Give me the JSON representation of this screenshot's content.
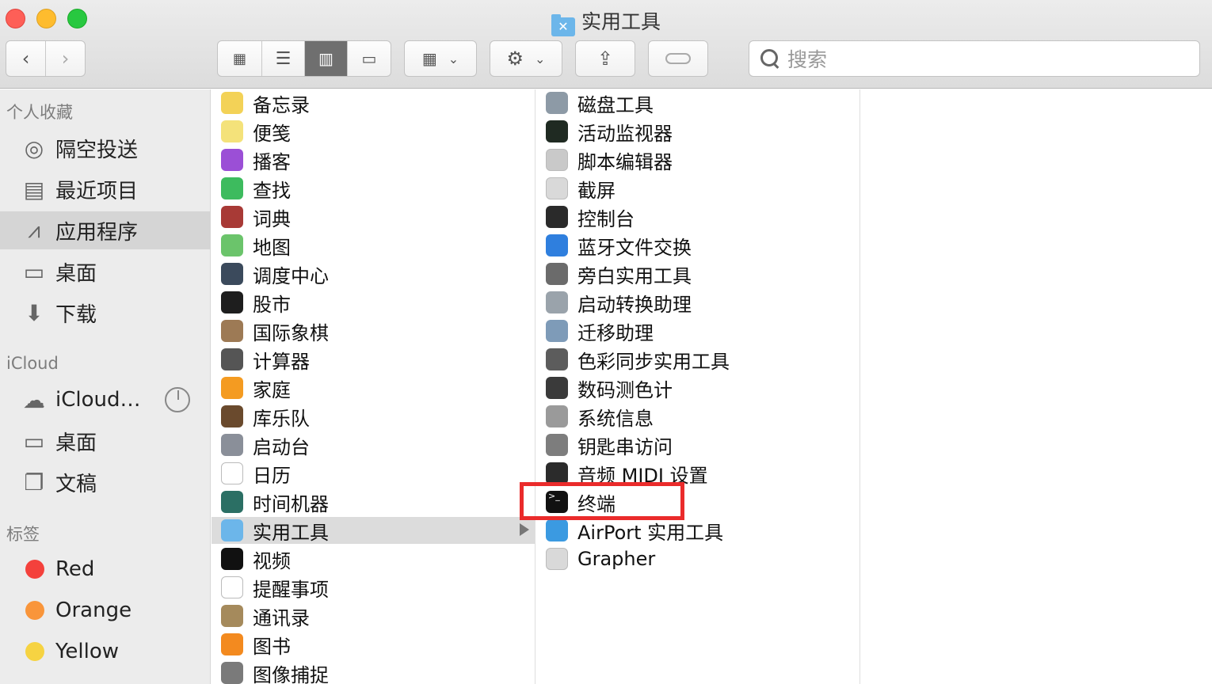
{
  "window": {
    "title": "实用工具"
  },
  "toolbar": {
    "back_icon": "chevron-left-icon",
    "forward_icon": "chevron-right-icon",
    "view_modes": [
      "icon-view",
      "list-view",
      "column-view",
      "gallery-view"
    ],
    "active_view": "column-view",
    "search_placeholder": "搜索"
  },
  "sidebar": {
    "favorites_header": "个人收藏",
    "favorites": [
      {
        "label": "隔空投送",
        "icon": "airdrop-icon"
      },
      {
        "label": "最近项目",
        "icon": "recents-icon"
      },
      {
        "label": "应用程序",
        "icon": "applications-icon",
        "selected": true
      },
      {
        "label": "桌面",
        "icon": "desktop-icon"
      },
      {
        "label": "下载",
        "icon": "downloads-icon"
      }
    ],
    "icloud_header": "iCloud",
    "icloud": [
      {
        "label": "iCloud…",
        "icon": "icloud-drive-icon"
      },
      {
        "label": "桌面",
        "icon": "desktop-icon"
      },
      {
        "label": "文稿",
        "icon": "documents-icon"
      }
    ],
    "tags_header": "标签",
    "tags": [
      {
        "label": "Red",
        "color": "#f4413c"
      },
      {
        "label": "Orange",
        "color": "#f9953a"
      },
      {
        "label": "Yellow",
        "color": "#f6d342"
      }
    ]
  },
  "column1": {
    "items": [
      {
        "label": "备忘录",
        "icon": "notes-icon",
        "color": "#f3d257"
      },
      {
        "label": "便笺",
        "icon": "stickies-icon",
        "color": "#f4e27a"
      },
      {
        "label": "播客",
        "icon": "podcasts-icon",
        "color": "#9b4fd6"
      },
      {
        "label": "查找",
        "icon": "find-my-icon",
        "color": "#3dbb5e"
      },
      {
        "label": "词典",
        "icon": "dictionary-icon",
        "color": "#a83a36"
      },
      {
        "label": "地图",
        "icon": "maps-icon",
        "color": "#6bc46b"
      },
      {
        "label": "调度中心",
        "icon": "mission-control-icon",
        "color": "#3b4a5c"
      },
      {
        "label": "股市",
        "icon": "stocks-icon",
        "color": "#1e1e1e"
      },
      {
        "label": "国际象棋",
        "icon": "chess-icon",
        "color": "#9d7a55"
      },
      {
        "label": "计算器",
        "icon": "calculator-icon",
        "color": "#555555"
      },
      {
        "label": "家庭",
        "icon": "home-icon",
        "color": "#f49b21"
      },
      {
        "label": "库乐队",
        "icon": "garageband-icon",
        "color": "#6a4a2d"
      },
      {
        "label": "启动台",
        "icon": "launchpad-icon",
        "color": "#8a8f99"
      },
      {
        "label": "日历",
        "icon": "calendar-icon",
        "color": "#ffffff"
      },
      {
        "label": "时间机器",
        "icon": "time-machine-icon",
        "color": "#2b6f64"
      },
      {
        "label": "实用工具",
        "icon": "utilities-folder-icon",
        "color": "#6cb6ea",
        "selected": true
      },
      {
        "label": "视频",
        "icon": "apple-tv-icon",
        "color": "#111111"
      },
      {
        "label": "提醒事项",
        "icon": "reminders-icon",
        "color": "#ffffff"
      },
      {
        "label": "通讯录",
        "icon": "contacts-icon",
        "color": "#a58a5c"
      },
      {
        "label": "图书",
        "icon": "books-icon",
        "color": "#f38a1f"
      },
      {
        "label": "图像捕捉",
        "icon": "image-capture-icon",
        "color": "#7a7a7a"
      }
    ]
  },
  "column2": {
    "items": [
      {
        "label": "磁盘工具",
        "icon": "disk-utility-icon",
        "color": "#8d9aa6"
      },
      {
        "label": "活动监视器",
        "icon": "activity-monitor-icon",
        "color": "#1f2a22"
      },
      {
        "label": "脚本编辑器",
        "icon": "script-editor-icon",
        "color": "#c9c9c9"
      },
      {
        "label": "截屏",
        "icon": "screenshot-icon",
        "color": "#d9d9d9"
      },
      {
        "label": "控制台",
        "icon": "console-icon",
        "color": "#2a2a2a"
      },
      {
        "label": "蓝牙文件交换",
        "icon": "bluetooth-icon",
        "color": "#2f7fde"
      },
      {
        "label": "旁白实用工具",
        "icon": "voiceover-icon",
        "color": "#6b6b6b"
      },
      {
        "label": "启动转换助理",
        "icon": "boot-camp-icon",
        "color": "#9aa3ab"
      },
      {
        "label": "迁移助理",
        "icon": "migration-icon",
        "color": "#7e9bb8"
      },
      {
        "label": "色彩同步实用工具",
        "icon": "colorsync-icon",
        "color": "#5c5c5c"
      },
      {
        "label": "数码测色计",
        "icon": "color-meter-icon",
        "color": "#3a3a3a"
      },
      {
        "label": "系统信息",
        "icon": "system-info-icon",
        "color": "#9a9a9a"
      },
      {
        "label": "钥匙串访问",
        "icon": "keychain-icon",
        "color": "#7d7d7d"
      },
      {
        "label": "音频 MIDI 设置",
        "icon": "midi-icon",
        "color": "#2b2b2b"
      },
      {
        "label": "终端",
        "icon": "terminal-icon",
        "color": "#111111"
      },
      {
        "label": "AirPort 实用工具",
        "icon": "airport-icon",
        "color": "#3b9ae1"
      },
      {
        "label": "Grapher",
        "icon": "grapher-icon",
        "color": "#d9d9d9"
      }
    ]
  }
}
